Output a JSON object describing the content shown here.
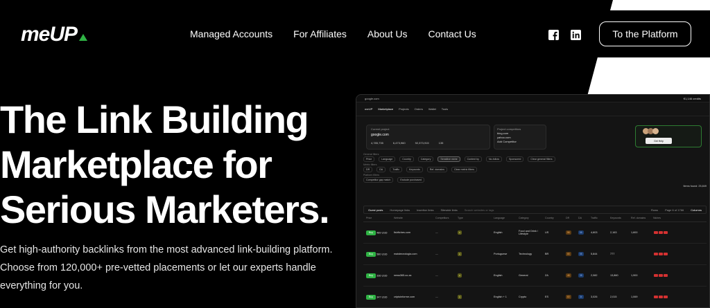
{
  "header": {
    "logo_text": "meUP",
    "nav": [
      "Managed Accounts",
      "For Affiliates",
      "About Us",
      "Contact Us"
    ],
    "social": [
      "facebook-icon",
      "linkedin-icon"
    ],
    "cta": "To the Platform"
  },
  "hero": {
    "title": "The Link Building Marketplace for Serious Marketers.",
    "subtitle": "Get high-authority backlinks from the most advanced link-building platform. Choose from 120,000+ pre-vetted placements or let our experts handle everything for you."
  },
  "dashboard": {
    "credits": "€1,146 credits",
    "nav": [
      "Marketplace",
      "Projects",
      "Orders",
      "Wallet",
      "Tools"
    ],
    "project_label": "Current project",
    "project_site": "google.com",
    "project_stats": [
      "4,785,735",
      "6,473,960",
      "92,373,915",
      "135"
    ],
    "competitors_label": "Project competitors",
    "competitors": [
      "bing.com",
      "yahoo.com"
    ],
    "add_competitor": "Add Competitor",
    "help_label": "Get Help",
    "general_filters_label": "General filters",
    "general_filters": [
      "Price",
      "Language",
      "Country",
      "Category",
      "Sensitive niche",
      "Content by",
      "No-follow",
      "Sponsored",
      "Clear general filters"
    ],
    "metric_filters_label": "Metric filters",
    "metric_filters": [
      "DR",
      "DA",
      "Traffic",
      "Keywords",
      "Ref. domains",
      "Clear metric filters"
    ],
    "platform_filters_label": "Platform filters",
    "platform_filters": [
      "Competitor gap match",
      "Exclude purchased"
    ],
    "items_found": "Items found: 25,849",
    "table_tabs": [
      "Guest posts",
      "Homepage links",
      "Insertion links",
      "Sitewide links"
    ],
    "search_placeholder": "Search websites or tags",
    "rows_label": "Rows",
    "page_label": "Page 6 of 1766",
    "columns_label": "Columns",
    "columns": [
      "Price",
      "Website",
      "Competitors",
      "Type",
      "Language",
      "Category",
      "Country",
      "DR",
      "DA",
      "Traffic",
      "Keywords",
      "Ref. domains",
      "Niches"
    ],
    "rows": [
      {
        "price": "489 USD",
        "site": "fishfiches.com",
        "lang": "English",
        "category": "Food and Drink / Lifestyle",
        "country": "US",
        "dr": "58",
        "da": "58",
        "traffic": "4,603",
        "kw": "2,163",
        "ref": "1,600"
      },
      {
        "price": "580 USD",
        "site": "maistecnologia.com",
        "lang": "Portuguese",
        "category": "Technology",
        "country": "BR",
        "dr": "65",
        "da": "58",
        "traffic": "5,844",
        "kw": "777",
        "ref": ""
      },
      {
        "price": "336 USD",
        "site": "news365.co.za",
        "lang": "English",
        "category": "General",
        "country": "ZA",
        "dr": "48",
        "da": "38",
        "traffic": "2,082",
        "kw": "13,860",
        "ref": "1,900"
      },
      {
        "price": "347 USD",
        "site": "criptoinforme.com",
        "lang": "English + 1",
        "category": "Crypto",
        "country": "ES",
        "dr": "60",
        "da": "34",
        "traffic": "3,026",
        "kw": "2,015",
        "ref": "1,069"
      }
    ],
    "buy_label": "Buy"
  },
  "colors": {
    "background": "#000000",
    "accent_green": "#2fb344",
    "text": "#ffffff"
  }
}
